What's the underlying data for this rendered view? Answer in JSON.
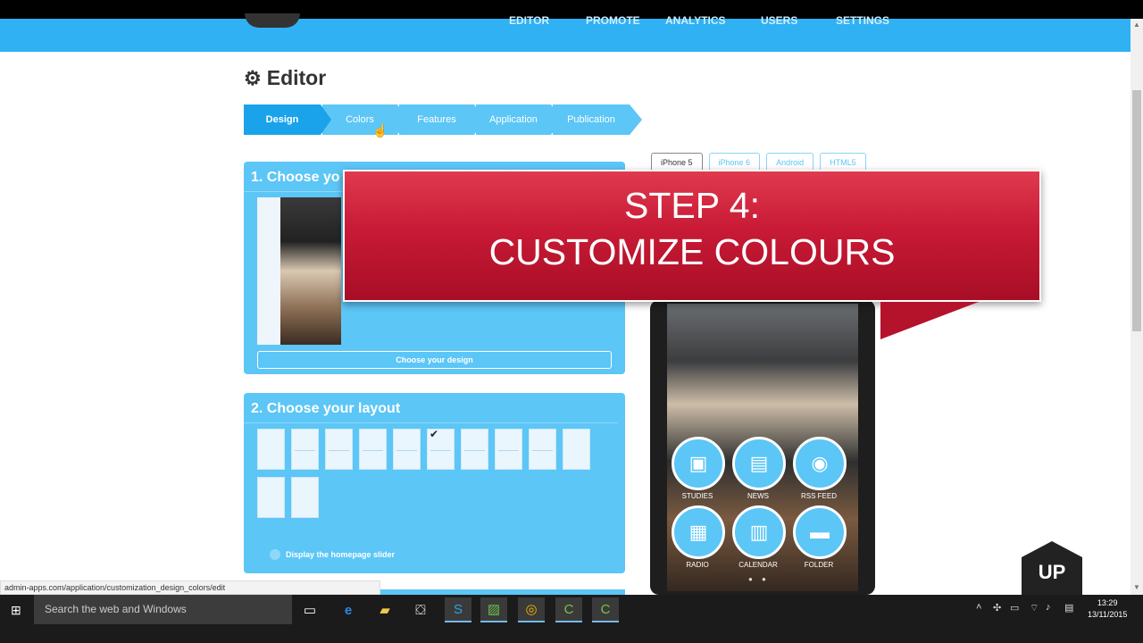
{
  "nav": {
    "items": [
      "EDITOR",
      "PROMOTE",
      "ANALYTICS",
      "USERS",
      "SETTINGS"
    ]
  },
  "page": {
    "title": "Editor"
  },
  "wizard": {
    "steps": [
      "Design",
      "Colors",
      "Features",
      "Application",
      "Publication"
    ]
  },
  "design_panel": {
    "title": "1. Choose yo",
    "button_label": "Choose your design"
  },
  "layout_panel": {
    "title": "2. Choose your layout",
    "slider_label": "Display the homepage slider"
  },
  "device_tabs": [
    "iPhone 5",
    "iPhone 6",
    "Android",
    "HTML5"
  ],
  "banner": {
    "line1": "STEP 4:",
    "line2": "CUSTOMIZE  COLOURS"
  },
  "phone_app": {
    "icons": [
      {
        "label": "STUDIES",
        "icon": "book-icon"
      },
      {
        "label": "NEWS",
        "icon": "newspaper-icon"
      },
      {
        "label": "RSS FEED",
        "icon": "rss-icon"
      },
      {
        "label": "RADIO",
        "icon": "radio-icon"
      },
      {
        "label": "CALENDAR",
        "icon": "calendar-icon"
      },
      {
        "label": "FOLDER",
        "icon": "folder-icon"
      }
    ]
  },
  "up_button": "UP",
  "status_url": "admin-apps.com/application/customization_design_colors/edit",
  "taskbar": {
    "search_placeholder": "Search the web and Windows",
    "time": "13:29",
    "date": "13/11/2015"
  },
  "colors": {
    "accent": "#5cc6f6",
    "accent_dark": "#1aa3ea",
    "banner_red": "#c81a36"
  }
}
